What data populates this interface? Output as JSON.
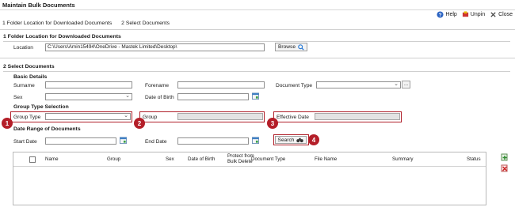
{
  "window": {
    "title": "Maintain Bulk Documents"
  },
  "toolbar": {
    "help": "Help",
    "unpin": "Unpin",
    "close": "Close"
  },
  "breadcrumb": {
    "step1": "1 Folder Location for Downloaded Documents",
    "step2": "2 Select Documents"
  },
  "folder_section": {
    "title": "1 Folder Location for Downloaded Documents",
    "location_label": "Location",
    "location_value": "C:\\Users\\Amin15494\\OneDrive - Mastek Limited\\Desktop\\",
    "browse_label": "Browse"
  },
  "select_section": {
    "title": "2 Select Documents",
    "basic_details": "Basic Details",
    "surname": "Surname",
    "forename": "Forename",
    "document_type": "Document Type",
    "sex": "Sex",
    "dob": "Date of Birth",
    "group_type_selection": "Group Type Selection",
    "group_type": "Group Type",
    "group": "Group",
    "effective_date": "Effective Date",
    "date_range": "Date Range of Documents",
    "start_date": "Start Date",
    "end_date": "End Date",
    "search_label": "Search",
    "doc_type_more": "..."
  },
  "badges": [
    "1",
    "2",
    "3",
    "4"
  ],
  "grid": {
    "columns": [
      "Name",
      "Group",
      "Sex",
      "Date of Birth",
      "Protect from Bulk Delete",
      "Document Type",
      "File Name",
      "Summary",
      "Status"
    ]
  },
  "colors": {
    "annotation_red": "#b41e28"
  }
}
